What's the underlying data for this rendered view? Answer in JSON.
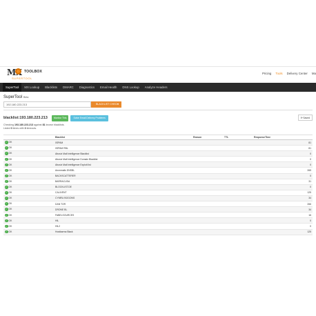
{
  "app": {
    "logo_main": "MX",
    "logo_toolbox": "TOOLBOX",
    "logo_sub": "SUPERTOOL"
  },
  "nav": [
    "Pricing",
    "Tools",
    "Delivery Center",
    "Ma"
  ],
  "nav_active": 1,
  "tabs": [
    "SuperTool",
    "MX Lookup",
    "Blacklists",
    "DMARC",
    "Diagnostics",
    "Email Health",
    "DNS Lookup",
    "Analyze Headers"
  ],
  "tab_active": 0,
  "page": {
    "title": "SuperTool",
    "title_badge": "Beta"
  },
  "search": {
    "value": "192.180.223.213",
    "button": "BLACKLIST CHECK",
    "caret": "▾"
  },
  "result": {
    "title": "blacklist:193.180.223.213",
    "monitor_button": "Monitor This",
    "delivery_button": "Solve Email Delivery Problems",
    "save_button": "Saved",
    "summary_line1_prefix": "Checking",
    "summary_ip": "193.180.223.213",
    "summary_line1_mid": "against",
    "summary_count": "81",
    "summary_line1_suffix": "known blacklists.",
    "summary_line2_prefix": "Listed",
    "summary_listed": "0",
    "summary_line2_mid": "times with",
    "summary_timeouts": "3",
    "summary_line2_suffix": "timeouts."
  },
  "table": {
    "columns": [
      "",
      "Blacklist",
      "Reason",
      "TTL",
      "ResponseTime"
    ],
    "status_icon": "✓",
    "rows": [
      {
        "status": "OK",
        "blacklist": "0SPAM",
        "reason": "",
        "ttl": "",
        "response": "81"
      },
      {
        "status": "OK",
        "blacklist": "0SPAM RBL",
        "reason": "",
        "ttl": "",
        "response": "81"
      },
      {
        "status": "OK",
        "blacklist": "Abusix Mail Intelligence Blacklist",
        "reason": "",
        "ttl": "",
        "response": "0"
      },
      {
        "status": "OK",
        "blacklist": "Abusix Mail Intelligence Domain Blacklist",
        "reason": "",
        "ttl": "",
        "response": "0"
      },
      {
        "status": "OK",
        "blacklist": "Abusix Mail Intelligence Exploit list",
        "reason": "",
        "ttl": "",
        "response": "0"
      },
      {
        "status": "OK",
        "blacklist": "Anonmails DNSBL",
        "reason": "",
        "ttl": "",
        "response": "265"
      },
      {
        "status": "OK",
        "blacklist": "BACKSCATTERER",
        "reason": "",
        "ttl": "",
        "response": "0"
      },
      {
        "status": "OK",
        "blacklist": "BARRACUDA",
        "reason": "",
        "ttl": "",
        "response": "31"
      },
      {
        "status": "OK",
        "blacklist": "BLOCKLIST.DE",
        "reason": "",
        "ttl": "",
        "response": "0"
      },
      {
        "status": "OK",
        "blacklist": "CALIVENT",
        "reason": "",
        "ttl": "",
        "response": "125"
      },
      {
        "status": "OK",
        "blacklist": "CYMRU BOGONS",
        "reason": "",
        "ttl": "",
        "response": "34"
      },
      {
        "status": "OK",
        "blacklist": "DAN TOR",
        "reason": "",
        "ttl": "",
        "response": "266"
      },
      {
        "status": "OK",
        "blacklist": "DRONE BL",
        "reason": "",
        "ttl": "",
        "response": "34"
      },
      {
        "status": "OK",
        "blacklist": "FABELSOURCES",
        "reason": "",
        "ttl": "",
        "response": "16"
      },
      {
        "status": "OK",
        "blacklist": "HIL",
        "reason": "",
        "ttl": "",
        "response": "0"
      },
      {
        "status": "OK",
        "blacklist": "HIL2",
        "reason": "",
        "ttl": "",
        "response": "0"
      },
      {
        "status": "OK",
        "blacklist": "Hostkarma Black",
        "reason": "",
        "ttl": "",
        "response": "125"
      }
    ]
  }
}
